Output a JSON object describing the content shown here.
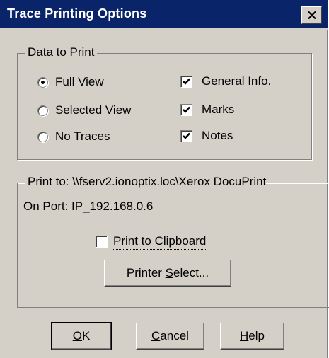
{
  "window": {
    "title": "Trace Printing Options",
    "close_glyph": "✕"
  },
  "data_group": {
    "legend": "Data to Print",
    "radios": [
      {
        "label": "Full View",
        "checked": true
      },
      {
        "label": "Selected View",
        "checked": false
      },
      {
        "label": "No Traces",
        "checked": false
      }
    ],
    "checkboxes": [
      {
        "label": "General Info.",
        "checked": true
      },
      {
        "label": "Marks",
        "checked": true
      },
      {
        "label": "Notes",
        "checked": true
      }
    ]
  },
  "print_group": {
    "print_to": "Print to: \\\\fserv2.ionoptix.loc\\Xerox DocuPrint",
    "on_port": "On Port: IP_192.168.0.6",
    "clipboard": {
      "label": "Print to Clipboard",
      "checked": false
    },
    "printer_select": {
      "prefix": "Printer ",
      "mnemonic": "S",
      "suffix": "elect..."
    }
  },
  "buttons": {
    "ok": {
      "mnemonic": "O",
      "rest": "K"
    },
    "cancel": {
      "mnemonic": "C",
      "rest": "ancel"
    },
    "help": {
      "mnemonic": "H",
      "rest": "elp"
    }
  },
  "colors": {
    "titlebar": "#0a246a",
    "face": "#d4d0c8"
  }
}
